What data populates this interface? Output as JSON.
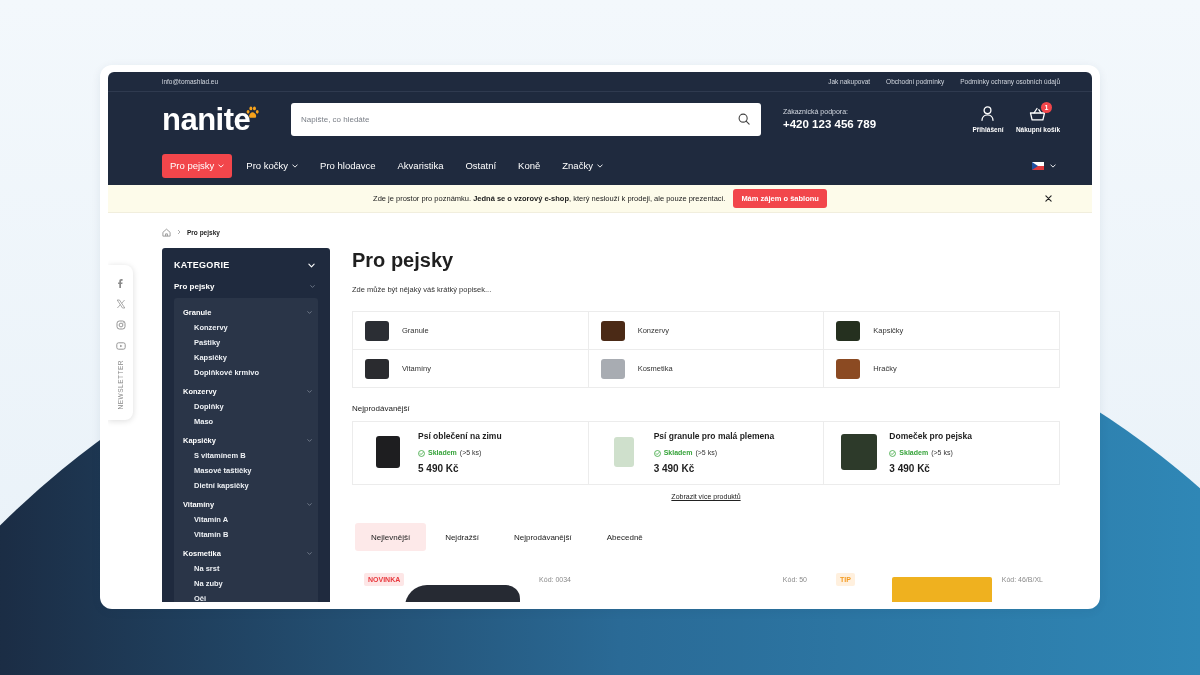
{
  "top_bar": {
    "email": "info@tomashlad.eu",
    "links": [
      "Jak nakupovat",
      "Obchodní podmínky",
      "Podmínky ochrany osobních údajů"
    ]
  },
  "header": {
    "logo": "nanite",
    "search": {
      "placeholder": "Napište, co hledáte"
    },
    "support": {
      "label": "Zákaznická podpora:",
      "phone": "+420 123 456 789"
    },
    "account": {
      "label": "Přihlášení"
    },
    "cart": {
      "label": "Nákupní košík",
      "count": "1"
    }
  },
  "nav": {
    "items": [
      {
        "label": "Pro pejsky",
        "selected": true,
        "has_menu": true
      },
      {
        "label": "Pro kočky",
        "selected": false,
        "has_menu": true
      },
      {
        "label": "Pro hlodavce",
        "selected": false,
        "has_menu": false
      },
      {
        "label": "Akvaristika",
        "selected": false,
        "has_menu": false
      },
      {
        "label": "Ostatní",
        "selected": false,
        "has_menu": false
      },
      {
        "label": "Koně",
        "selected": false,
        "has_menu": false
      },
      {
        "label": "Značky",
        "selected": false,
        "has_menu": true
      }
    ]
  },
  "notice": {
    "text": "Zde je prostor pro poznámku. **Jedná se o vzorový e-shop**, který neslouží k prodeji, ale pouze prezentaci.",
    "button": "Mám zájem o šablonu"
  },
  "breadcrumb": [
    "Pro pejsky"
  ],
  "social": {
    "newsletter": "NEWSLETTER"
  },
  "sidebar": {
    "title": "KATEGORIE",
    "expanded": true,
    "items": [
      {
        "label": "Pro pejsky",
        "expanded": true,
        "children": [
          {
            "label": "Granule",
            "expanded": true,
            "children": [
              {
                "label": "Konzervy"
              },
              {
                "label": "Paštiky"
              },
              {
                "label": "Kapsičky"
              },
              {
                "label": "Doplňkové krmivo"
              }
            ]
          },
          {
            "label": "Konzervy",
            "expanded": true,
            "children": [
              {
                "label": "Doplňky"
              },
              {
                "label": "Maso"
              }
            ]
          },
          {
            "label": "Kapsičky",
            "expanded": true,
            "children": [
              {
                "label": "S vitamínem B"
              },
              {
                "label": "Masové taštičky"
              },
              {
                "label": "Dietní kapsičky"
              }
            ]
          },
          {
            "label": "Vitamíny",
            "expanded": true,
            "children": [
              {
                "label": "Vitamín A"
              },
              {
                "label": "Vitamín B"
              }
            ]
          },
          {
            "label": "Kosmetika",
            "expanded": true,
            "children": [
              {
                "label": "Na srst"
              },
              {
                "label": "Na zuby"
              },
              {
                "label": "Oči"
              }
            ]
          }
        ]
      }
    ]
  },
  "page": {
    "title": "Pro pejsky",
    "description": "Zde může být nějaký váš krátký popisek...",
    "categories": [
      "Granule",
      "Konzervy",
      "Kapsičky",
      "Vitamíny",
      "Kosmetika",
      "Hračky"
    ]
  },
  "bestsellers": {
    "title": "Nejprodávanější",
    "products": [
      {
        "name": "Psí oblečení na zimu",
        "in_stock": true,
        "stock": "Skladem",
        "stock_note": "(>5 ks)",
        "price": "5 490 Kč"
      },
      {
        "name": "Psí granule pro malá plemena",
        "in_stock": true,
        "stock": "Skladem",
        "stock_note": "(>5 ks)",
        "price": "3 490 Kč"
      },
      {
        "name": "Domeček pro pejska",
        "in_stock": true,
        "stock": "Skladem",
        "stock_note": "(>5 ks)",
        "price": "3 490 Kč"
      }
    ],
    "more_link": "Zobrazit více produktů"
  },
  "sort_tabs": [
    {
      "label": "Nejlevnější",
      "selected": true
    },
    {
      "label": "Nejdražší",
      "selected": false
    },
    {
      "label": "Nejprodávanější",
      "selected": false
    },
    {
      "label": "Abecedně",
      "selected": false
    }
  ],
  "products": [
    {
      "badge": {
        "kind": "new",
        "text": "NOVINKA"
      },
      "code": "Kód: 0034"
    },
    {
      "code": "Kód: 50"
    },
    {
      "badge": {
        "kind": "tip",
        "text": "TIP"
      },
      "code": "Kód: 46/B/XL"
    }
  ]
}
